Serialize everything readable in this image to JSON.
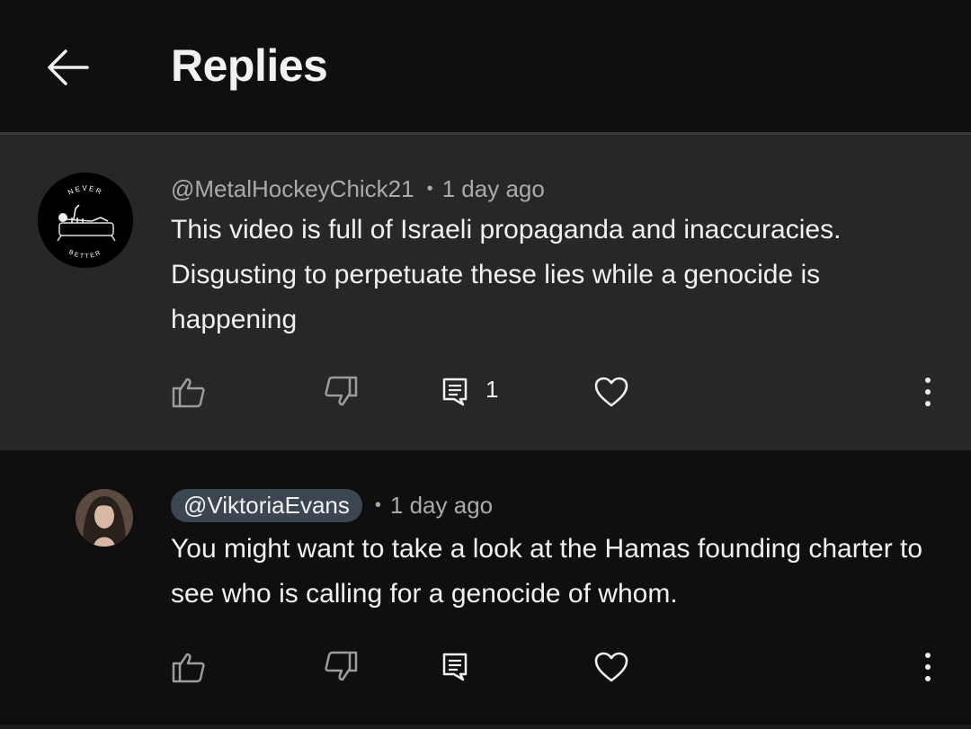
{
  "header": {
    "title": "Replies",
    "back_icon": "arrow-left-icon"
  },
  "comments": [
    {
      "handle": "@MetalHockeyChick21",
      "time": "1 day ago",
      "text": "This video is full of Israeli propaganda and inaccuracies. Disgusting to perpetuate these lies while a genocide is happening",
      "avatar_text_top": "NEVER",
      "avatar_text_bottom": "BETTER",
      "reply_count": "1"
    },
    {
      "handle": "@ViktoriaEvans",
      "time": "1 day ago",
      "text": "You might want to take a look at the Hamas founding charter to see who is calling for a genocide of whom."
    }
  ],
  "icons": {
    "like": "thumbs-up-icon",
    "dislike": "thumbs-down-icon",
    "reply": "reply-icon",
    "heart": "heart-icon",
    "more": "more-vertical-icon"
  },
  "colors": {
    "background": "#0f0f0f",
    "highlighted_background": "#272727",
    "primary_text": "#f1f1f1",
    "secondary_text": "#aaaaaa",
    "handle_chip": "#3b4650"
  }
}
